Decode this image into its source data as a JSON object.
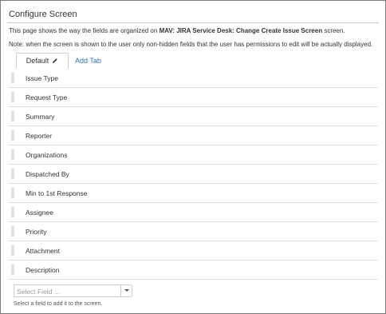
{
  "page": {
    "title": "Configure Screen",
    "desc_prefix": "This page shows the way the fields are organized on ",
    "desc_screen_name": "MAV: JIRA Service Desk: Change Create Issue Screen",
    "desc_suffix": " screen.",
    "note": "Note: when the screen is shown to the user only non-hidden fields that the user has permissions to edit will be actually displayed."
  },
  "tabs": {
    "active_label": "Default",
    "add_label": "Add Tab"
  },
  "fields": [
    {
      "label": "Issue Type"
    },
    {
      "label": "Request Type"
    },
    {
      "label": "Summary"
    },
    {
      "label": "Reporter"
    },
    {
      "label": "Organizations"
    },
    {
      "label": "Dispatched By"
    },
    {
      "label": "Min to 1st Response"
    },
    {
      "label": "Assignee"
    },
    {
      "label": "Priority"
    },
    {
      "label": "Attachment"
    },
    {
      "label": "Description"
    }
  ],
  "add_field": {
    "placeholder": "Select Field ...",
    "helper": "Select a field to add it to the screen."
  },
  "colors": {
    "link": "#3572b0",
    "border": "#cccccc",
    "text": "#333333"
  },
  "icons": {
    "edit": "pencil-icon",
    "drag": "drag-handle-icon",
    "dropdown": "chevron-down-icon"
  }
}
